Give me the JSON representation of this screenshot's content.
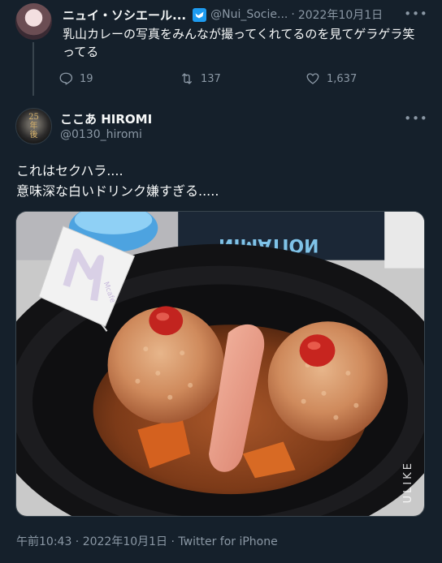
{
  "quoted_tweet": {
    "display_name": "ニュイ・ソシエール...",
    "handle": "@Nui_Socie...",
    "separator": "·",
    "date": "2022年10月1日",
    "text": "乳山カレーの写真をみんなが撮ってくれてるのを見てゲラゲラ笑ってる",
    "reply_count": "19",
    "retweet_count": "137",
    "like_count": "1,637"
  },
  "main_tweet": {
    "display_name": "ここあ HIROMI",
    "handle": "@0130_hiromi",
    "avatar_text": "25\n年\n後",
    "text": "これはセクハラ....\n意味深な白いドリンク嫌すぎる.....",
    "media_watermark": "ULIKE",
    "media_sign_text": "NIMATION",
    "flag_text": "Mcafe",
    "timestamp": "午前10:43 · 2022年10月1日 · ",
    "source": "Twitter for iPhone"
  },
  "colors": {
    "background": "#15202b",
    "text_primary": "#f7f9f9",
    "text_secondary": "#8b98a5",
    "verified_blue": "#1d9bf0",
    "divider": "#38444d"
  },
  "icons": [
    "verified-badge-icon",
    "more-icon",
    "reply-icon",
    "retweet-icon",
    "like-icon"
  ]
}
